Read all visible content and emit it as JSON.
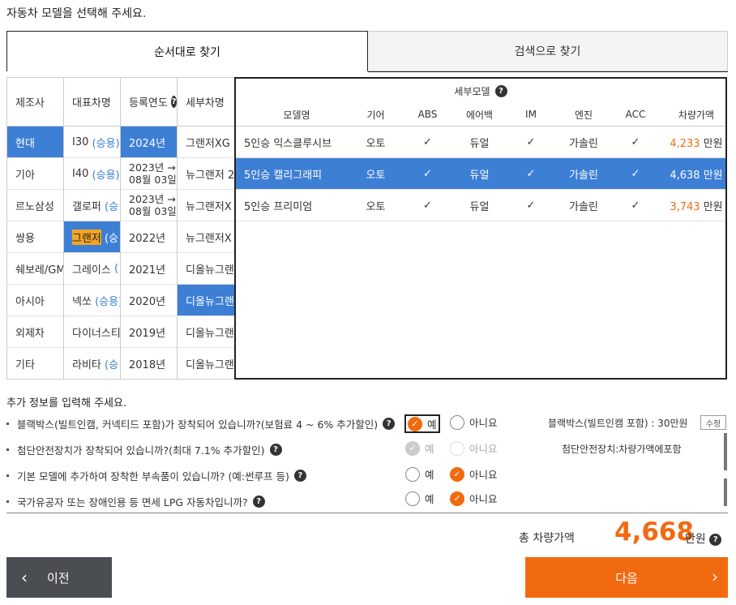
{
  "heading": "자동차 모델을 선택해 주세요.",
  "tabs": [
    {
      "label": "순서대로 찾기"
    },
    {
      "label": "검색으로 찾기"
    }
  ],
  "columns": {
    "maker": {
      "header": "제조사",
      "items": [
        "현대",
        "기아",
        "르노삼성",
        "쌍용",
        "쉐보레/GM",
        "아시아",
        "외제차",
        "기타"
      ]
    },
    "model": {
      "header": "대표차명",
      "items": [
        {
          "name": "I30",
          "type": "(승용)"
        },
        {
          "name": "I40",
          "type": "(승용)"
        },
        {
          "name": "갤로퍼",
          "type": "(승"
        },
        {
          "name": "그랜저",
          "type": "(승"
        },
        {
          "name": "그레이스",
          "type": "("
        },
        {
          "name": "넥쏘",
          "type": "(승용)"
        },
        {
          "name": "다이너스티",
          "type": ""
        },
        {
          "name": "라비타",
          "type": "(승"
        }
      ]
    },
    "year": {
      "header": "등록연도",
      "items": [
        {
          "line1": "2024년",
          "line2": ""
        },
        {
          "line1": "2023년 →",
          "line2": "08월 03일"
        },
        {
          "line1": "2023년 →",
          "line2": "08월 03일"
        },
        {
          "line1": "2022년",
          "line2": ""
        },
        {
          "line1": "2021년",
          "line2": ""
        },
        {
          "line1": "2020년",
          "line2": ""
        },
        {
          "line1": "2019년",
          "line2": ""
        },
        {
          "line1": "2018년",
          "line2": ""
        }
      ]
    },
    "detail": {
      "header": "세부차명",
      "items": [
        "그랜저XG",
        "뉴그랜저 2",
        "뉴그랜저X",
        "뉴그랜저X",
        "디올뉴그랜",
        "디올뉴그랜",
        "디올뉴그랜",
        "디올뉴그랜"
      ]
    }
  },
  "detail_panel": {
    "title": "세부모델",
    "headers": [
      "모델명",
      "기어",
      "ABS",
      "에어백",
      "IM",
      "엔진",
      "ACC",
      "차량가액"
    ],
    "rows": [
      {
        "name": "5인승 익스클루시브",
        "gear": "오토",
        "abs": "✓",
        "airbag": "듀얼",
        "im": "✓",
        "engine": "가솔린",
        "acc": "✓",
        "price": "4,233",
        "unit": "만원"
      },
      {
        "name": "5인승 캘리그래피",
        "gear": "오토",
        "abs": "✓",
        "airbag": "듀얼",
        "im": "✓",
        "engine": "가솔린",
        "acc": "✓",
        "price": "4,638",
        "unit": "만원"
      },
      {
        "name": "5인승 프리미엄",
        "gear": "오토",
        "abs": "✓",
        "airbag": "듀얼",
        "im": "✓",
        "engine": "가솔린",
        "acc": "✓",
        "price": "3,743",
        "unit": "만원"
      }
    ]
  },
  "extra": {
    "heading": "추가 정보를 입력해 주세요.",
    "questions": [
      {
        "text": "블랙박스(빌트인캠, 커넥티드 포함)가 장착되어 있습니까?(보험료 4 ~ 6% 추가할인)",
        "yes": "예",
        "no": "아니요",
        "side": "블랙박스(빌트인캠 포함) : 30만원",
        "edit": "수정"
      },
      {
        "text": "첨단안전장치가 장착되어 있습니까?(최대 7.1% 추가할인)",
        "yes": "예",
        "no": "아니요",
        "side": "첨단안전장치:차량가액에포함"
      },
      {
        "text": "기본 모델에 추가하여 장착한 부속품이 있습니까? (예:썬루프 등)",
        "yes": "예",
        "no": "아니요"
      },
      {
        "text": "국가유공자 또는 장애인용 등 면세 LPG 자동차입니까?",
        "yes": "예",
        "no": "아니요"
      }
    ]
  },
  "total": {
    "label": "총 차량가액",
    "value": "4,668",
    "unit": "만원"
  },
  "buttons": {
    "prev": "이전",
    "next": "다음"
  }
}
